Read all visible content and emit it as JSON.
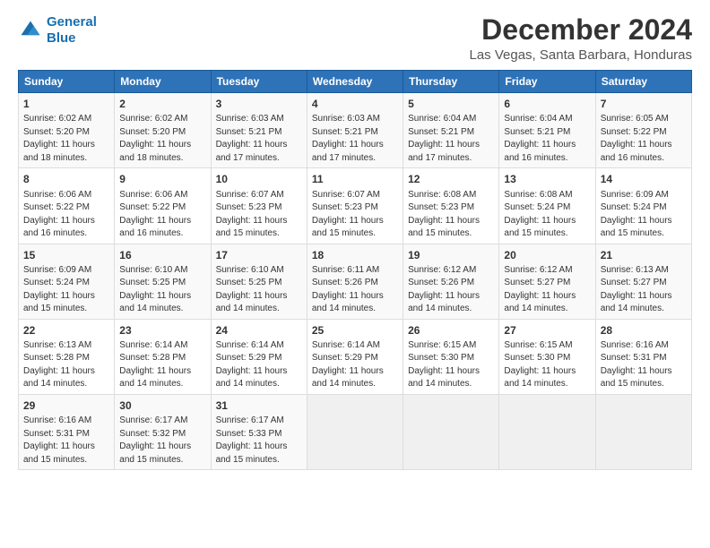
{
  "logo": {
    "line1": "General",
    "line2": "Blue"
  },
  "title": "December 2024",
  "subtitle": "Las Vegas, Santa Barbara, Honduras",
  "days_header": [
    "Sunday",
    "Monday",
    "Tuesday",
    "Wednesday",
    "Thursday",
    "Friday",
    "Saturday"
  ],
  "weeks": [
    [
      {
        "num": "1",
        "rise": "6:02 AM",
        "set": "5:20 PM",
        "daylight": "11 hours and 18 minutes."
      },
      {
        "num": "2",
        "rise": "6:02 AM",
        "set": "5:20 PM",
        "daylight": "11 hours and 18 minutes."
      },
      {
        "num": "3",
        "rise": "6:03 AM",
        "set": "5:21 PM",
        "daylight": "11 hours and 17 minutes."
      },
      {
        "num": "4",
        "rise": "6:03 AM",
        "set": "5:21 PM",
        "daylight": "11 hours and 17 minutes."
      },
      {
        "num": "5",
        "rise": "6:04 AM",
        "set": "5:21 PM",
        "daylight": "11 hours and 17 minutes."
      },
      {
        "num": "6",
        "rise": "6:04 AM",
        "set": "5:21 PM",
        "daylight": "11 hours and 16 minutes."
      },
      {
        "num": "7",
        "rise": "6:05 AM",
        "set": "5:22 PM",
        "daylight": "11 hours and 16 minutes."
      }
    ],
    [
      {
        "num": "8",
        "rise": "6:06 AM",
        "set": "5:22 PM",
        "daylight": "11 hours and 16 minutes."
      },
      {
        "num": "9",
        "rise": "6:06 AM",
        "set": "5:22 PM",
        "daylight": "11 hours and 16 minutes."
      },
      {
        "num": "10",
        "rise": "6:07 AM",
        "set": "5:23 PM",
        "daylight": "11 hours and 15 minutes."
      },
      {
        "num": "11",
        "rise": "6:07 AM",
        "set": "5:23 PM",
        "daylight": "11 hours and 15 minutes."
      },
      {
        "num": "12",
        "rise": "6:08 AM",
        "set": "5:23 PM",
        "daylight": "11 hours and 15 minutes."
      },
      {
        "num": "13",
        "rise": "6:08 AM",
        "set": "5:24 PM",
        "daylight": "11 hours and 15 minutes."
      },
      {
        "num": "14",
        "rise": "6:09 AM",
        "set": "5:24 PM",
        "daylight": "11 hours and 15 minutes."
      }
    ],
    [
      {
        "num": "15",
        "rise": "6:09 AM",
        "set": "5:24 PM",
        "daylight": "11 hours and 15 minutes."
      },
      {
        "num": "16",
        "rise": "6:10 AM",
        "set": "5:25 PM",
        "daylight": "11 hours and 14 minutes."
      },
      {
        "num": "17",
        "rise": "6:10 AM",
        "set": "5:25 PM",
        "daylight": "11 hours and 14 minutes."
      },
      {
        "num": "18",
        "rise": "6:11 AM",
        "set": "5:26 PM",
        "daylight": "11 hours and 14 minutes."
      },
      {
        "num": "19",
        "rise": "6:12 AM",
        "set": "5:26 PM",
        "daylight": "11 hours and 14 minutes."
      },
      {
        "num": "20",
        "rise": "6:12 AM",
        "set": "5:27 PM",
        "daylight": "11 hours and 14 minutes."
      },
      {
        "num": "21",
        "rise": "6:13 AM",
        "set": "5:27 PM",
        "daylight": "11 hours and 14 minutes."
      }
    ],
    [
      {
        "num": "22",
        "rise": "6:13 AM",
        "set": "5:28 PM",
        "daylight": "11 hours and 14 minutes."
      },
      {
        "num": "23",
        "rise": "6:14 AM",
        "set": "5:28 PM",
        "daylight": "11 hours and 14 minutes."
      },
      {
        "num": "24",
        "rise": "6:14 AM",
        "set": "5:29 PM",
        "daylight": "11 hours and 14 minutes."
      },
      {
        "num": "25",
        "rise": "6:14 AM",
        "set": "5:29 PM",
        "daylight": "11 hours and 14 minutes."
      },
      {
        "num": "26",
        "rise": "6:15 AM",
        "set": "5:30 PM",
        "daylight": "11 hours and 14 minutes."
      },
      {
        "num": "27",
        "rise": "6:15 AM",
        "set": "5:30 PM",
        "daylight": "11 hours and 14 minutes."
      },
      {
        "num": "28",
        "rise": "6:16 AM",
        "set": "5:31 PM",
        "daylight": "11 hours and 15 minutes."
      }
    ],
    [
      {
        "num": "29",
        "rise": "6:16 AM",
        "set": "5:31 PM",
        "daylight": "11 hours and 15 minutes."
      },
      {
        "num": "30",
        "rise": "6:17 AM",
        "set": "5:32 PM",
        "daylight": "11 hours and 15 minutes."
      },
      {
        "num": "31",
        "rise": "6:17 AM",
        "set": "5:33 PM",
        "daylight": "11 hours and 15 minutes."
      },
      null,
      null,
      null,
      null
    ]
  ]
}
